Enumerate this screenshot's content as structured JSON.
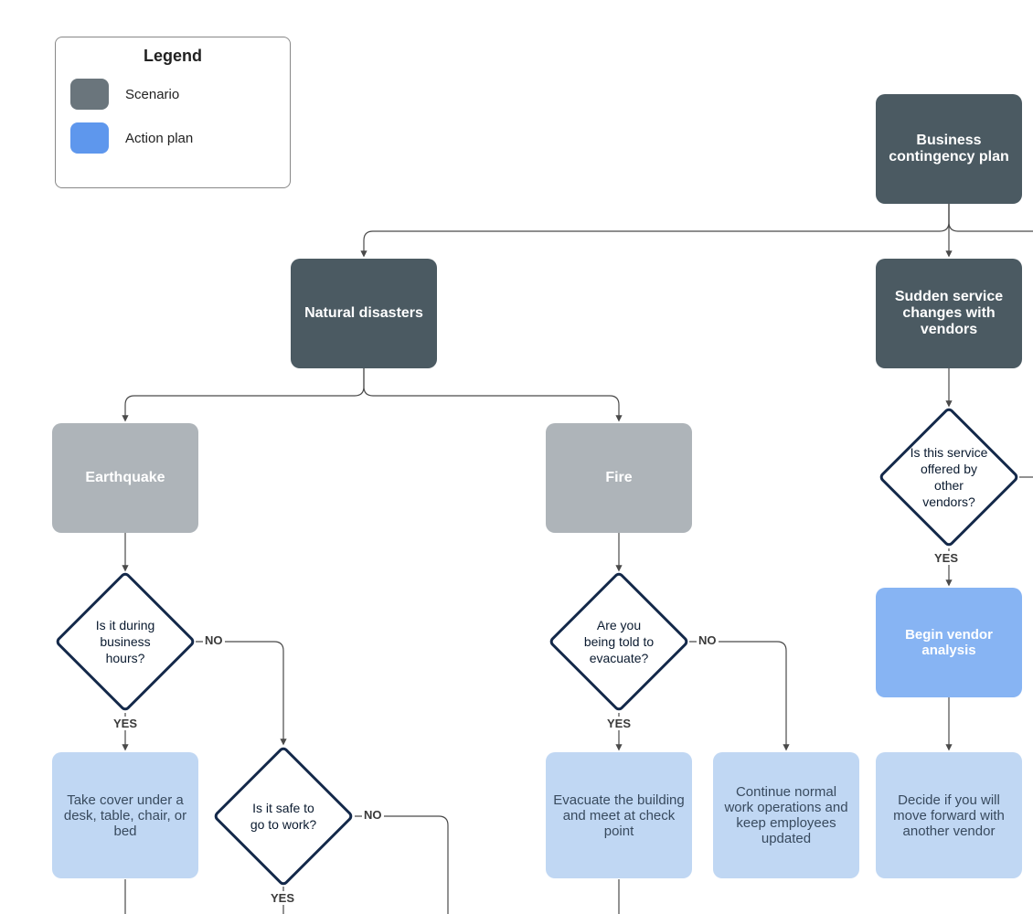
{
  "legend": {
    "title": "Legend",
    "items": [
      {
        "label": "Scenario",
        "color": "#6a757c"
      },
      {
        "label": "Action plan",
        "color": "#5e97ed"
      }
    ]
  },
  "nodes": {
    "root": "Business contingency plan",
    "natural": "Natural disasters",
    "vendors": "Sudden service changes with vendors",
    "earthquake": "Earthquake",
    "fire": "Fire",
    "q_hours": "Is it during business hours?",
    "q_safe": "Is it safe to go to work?",
    "q_evacuate": "Are you being told to evacuate?",
    "q_service": "Is this service offered by other vendors?",
    "a_cover": "Take cover under a desk, table, chair, or bed",
    "a_evacuate": "Evacuate the building and meet at check point",
    "a_continue": "Continue normal work operations and keep employees updated",
    "a_begin": "Begin vendor analysis",
    "a_decide": "Decide if you will move forward with another vendor"
  },
  "edge_labels": {
    "yes": "YES",
    "no": "NO"
  },
  "colors": {
    "scenario_dark": "#4b5a62",
    "scenario_light": "#aeb4b9",
    "action_medium": "#87b4f3",
    "action_light": "#c0d7f3",
    "diamond_stroke": "#14294a",
    "edge_stroke": "#4a4a4a"
  },
  "chart_data": {
    "type": "flowchart",
    "title": "Business contingency plan",
    "legend": [
      "Scenario",
      "Action plan"
    ],
    "nodes": [
      {
        "id": "root",
        "kind": "scenario",
        "label": "Business contingency plan"
      },
      {
        "id": "natural",
        "kind": "scenario",
        "label": "Natural disasters"
      },
      {
        "id": "vendors",
        "kind": "scenario",
        "label": "Sudden service changes with vendors"
      },
      {
        "id": "earthquake",
        "kind": "scenario",
        "label": "Earthquake"
      },
      {
        "id": "fire",
        "kind": "scenario",
        "label": "Fire"
      },
      {
        "id": "q_hours",
        "kind": "decision",
        "label": "Is it during business hours?"
      },
      {
        "id": "q_safe",
        "kind": "decision",
        "label": "Is it safe to go to work?"
      },
      {
        "id": "q_evacuate",
        "kind": "decision",
        "label": "Are you being told to evacuate?"
      },
      {
        "id": "q_service",
        "kind": "decision",
        "label": "Is this service offered by other vendors?"
      },
      {
        "id": "a_cover",
        "kind": "action",
        "label": "Take cover under a desk, table, chair, or bed"
      },
      {
        "id": "a_evacuate",
        "kind": "action",
        "label": "Evacuate the building and meet at check point"
      },
      {
        "id": "a_continue",
        "kind": "action",
        "label": "Continue normal work operations and keep employees updated"
      },
      {
        "id": "a_begin",
        "kind": "action",
        "label": "Begin vendor analysis"
      },
      {
        "id": "a_decide",
        "kind": "action",
        "label": "Decide if you will move forward with another vendor"
      }
    ],
    "edges": [
      {
        "from": "root",
        "to": "natural",
        "label": ""
      },
      {
        "from": "root",
        "to": "vendors",
        "label": ""
      },
      {
        "from": "natural",
        "to": "earthquake",
        "label": ""
      },
      {
        "from": "natural",
        "to": "fire",
        "label": ""
      },
      {
        "from": "earthquake",
        "to": "q_hours",
        "label": ""
      },
      {
        "from": "q_hours",
        "to": "a_cover",
        "label": "YES"
      },
      {
        "from": "q_hours",
        "to": "q_safe",
        "label": "NO"
      },
      {
        "from": "q_safe",
        "to": "",
        "label": "YES"
      },
      {
        "from": "q_safe",
        "to": "",
        "label": "NO"
      },
      {
        "from": "fire",
        "to": "q_evacuate",
        "label": ""
      },
      {
        "from": "q_evacuate",
        "to": "a_evacuate",
        "label": "YES"
      },
      {
        "from": "q_evacuate",
        "to": "a_continue",
        "label": "NO"
      },
      {
        "from": "vendors",
        "to": "q_service",
        "label": ""
      },
      {
        "from": "q_service",
        "to": "a_begin",
        "label": "YES"
      },
      {
        "from": "a_begin",
        "to": "a_decide",
        "label": ""
      }
    ]
  }
}
